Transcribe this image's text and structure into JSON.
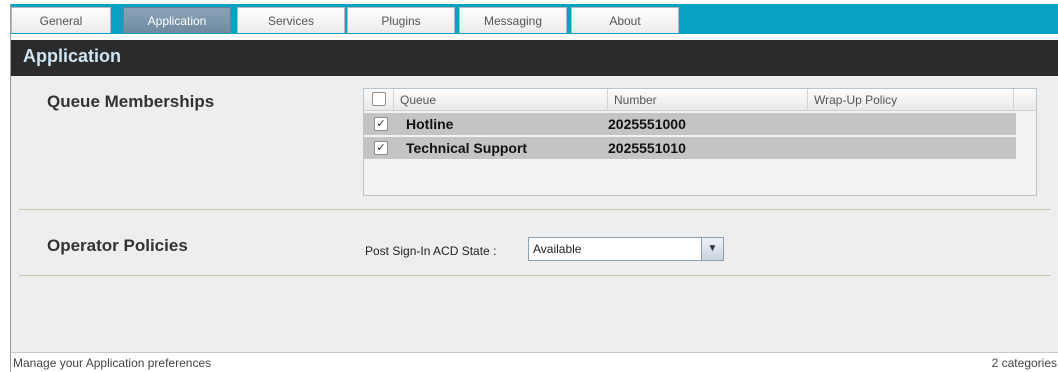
{
  "tabs": [
    {
      "label": "General"
    },
    {
      "label": "Application"
    },
    {
      "label": "Services"
    },
    {
      "label": "Plugins"
    },
    {
      "label": "Messaging"
    },
    {
      "label": "About"
    }
  ],
  "active_tab": "Application",
  "header": {
    "title": "Application"
  },
  "queue_memberships": {
    "title": "Queue Memberships",
    "columns": [
      "Queue",
      "Number",
      "Wrap-Up Policy"
    ],
    "rows": [
      {
        "checked": true,
        "queue": "Hotline",
        "number": "2025551000",
        "wrap_up_policy": ""
      },
      {
        "checked": true,
        "queue": "Technical Support",
        "number": "2025551010",
        "wrap_up_policy": ""
      }
    ]
  },
  "operator_policies": {
    "title": "Operator Policies",
    "acd_label": "Post Sign-In ACD State :",
    "acd_value": "Available"
  },
  "status": {
    "left": "Manage your Application preferences",
    "right": "2 categories"
  },
  "colors": {
    "tab_bar": "#0aa2c4",
    "header_bg": "#2b2b2b",
    "header_text": "#cfe4f2",
    "active_tab": "#7a94aa",
    "row_bg": "#c4c4c4"
  }
}
